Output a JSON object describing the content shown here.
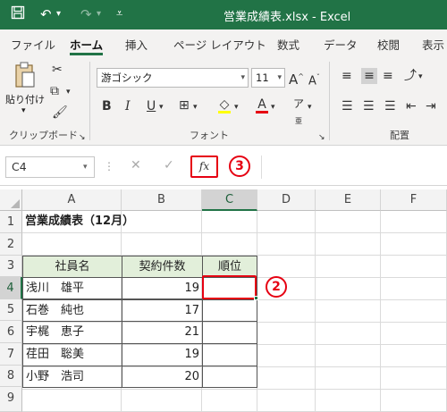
{
  "titlebar": {
    "save_icon": "save-icon",
    "undo_icon": "undo-icon",
    "redo_icon": "redo-icon",
    "customize_icon": "customize-icon",
    "title": "営業成績表.xlsx  -  Excel"
  },
  "tabs": [
    "ファイル",
    "ホーム",
    "挿入",
    "ページ レイアウト",
    "数式",
    "データ",
    "校閲",
    "表示"
  ],
  "active_tab": "ホーム",
  "ribbon": {
    "clipboard": {
      "paste_label": "貼り付け",
      "group_label": "クリップボード"
    },
    "font": {
      "font_name": "游ゴシック",
      "font_size": "11",
      "group_label": "フォント"
    },
    "alignment": {
      "group_label": "配置"
    }
  },
  "formula_bar": {
    "name_box": "C4",
    "fx_label": "fx",
    "formula": ""
  },
  "callouts": {
    "fx": "3",
    "cell": "2"
  },
  "sheet": {
    "columns": [
      "A",
      "B",
      "C",
      "D",
      "E",
      "F"
    ],
    "rows": [
      "1",
      "2",
      "3",
      "4",
      "5",
      "6",
      "7",
      "8",
      "9"
    ],
    "title": "営業成績表（12月）",
    "headers": [
      "社員名",
      "契約件数",
      "順位"
    ],
    "data": [
      {
        "name": "浅川　雄平",
        "count": "19",
        "rank": ""
      },
      {
        "name": "石巻　純也",
        "count": "17",
        "rank": ""
      },
      {
        "name": "宇梶　恵子",
        "count": "21",
        "rank": ""
      },
      {
        "name": "荏田　聡美",
        "count": "19",
        "rank": ""
      },
      {
        "name": "小野　浩司",
        "count": "20",
        "rank": ""
      }
    ]
  },
  "colors": {
    "excel_green": "#217346",
    "highlight_red": "#e60012",
    "header_fill": "#e2efda"
  }
}
